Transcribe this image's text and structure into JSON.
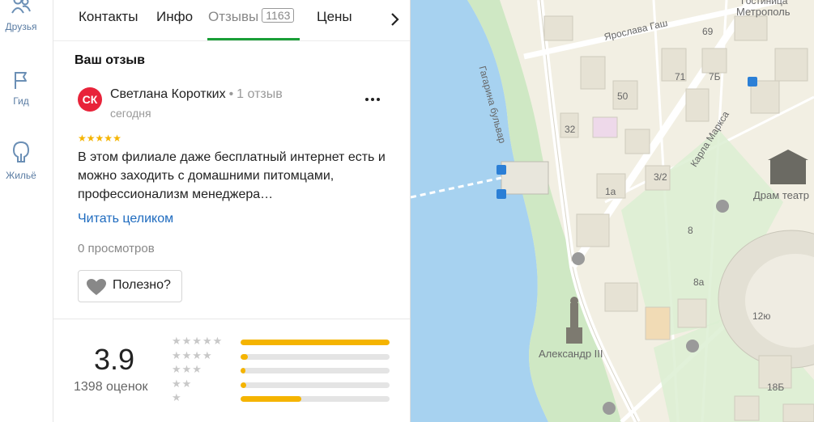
{
  "rail": {
    "items": [
      {
        "label": "Друзья",
        "icon": "friends-icon"
      },
      {
        "label": "Гид",
        "icon": "flag-icon"
      },
      {
        "label": "Жильё",
        "icon": "house-icon"
      }
    ]
  },
  "tabs": {
    "items": [
      {
        "label": "Контакты"
      },
      {
        "label": "Инфо"
      },
      {
        "label": "Отзывы",
        "count": "1163",
        "active": true
      },
      {
        "label": "Цены"
      }
    ],
    "next_icon": "chevron-right-icon"
  },
  "review": {
    "section_title": "Ваш отзыв",
    "avatar_initials": "СК",
    "avatar_color": "#e8233a",
    "author": "Светлана Коротких",
    "separator": "•",
    "author_reviews": "1 отзыв",
    "date": "сегодня",
    "stars": 5,
    "text": "В этом филиале даже бесплатный интернет есть и можно заходить с домашними питомцами, профессионализм менеджера…",
    "read_more": "Читать целиком",
    "views": "0 просмотров",
    "useful_label": "Полезно?"
  },
  "rating": {
    "value": "3.9",
    "count_label": "1398 оценок",
    "distribution": [
      {
        "stars": 5,
        "fraction": 1.0
      },
      {
        "stars": 4,
        "fraction": 0.05
      },
      {
        "stars": 3,
        "fraction": 0.03
      },
      {
        "stars": 2,
        "fraction": 0.04
      },
      {
        "stars": 1,
        "fraction": 0.41
      }
    ],
    "bar_color": "#f5b400"
  },
  "map": {
    "labels": [
      {
        "text": "Гагарина бульвар"
      },
      {
        "text": "Ярослава Гаш"
      },
      {
        "text": "Карла Маркса"
      },
      {
        "text": "Гостиница"
      },
      {
        "text": "Метрополь"
      },
      {
        "text": "Драм театр"
      },
      {
        "text": "Александр III"
      },
      {
        "text": "69"
      },
      {
        "text": "71"
      },
      {
        "text": "7Б"
      },
      {
        "text": "50"
      },
      {
        "text": "32"
      },
      {
        "text": "3/2"
      },
      {
        "text": "1а"
      },
      {
        "text": "8"
      },
      {
        "text": "8а"
      },
      {
        "text": "12ю"
      },
      {
        "text": "18Б"
      }
    ],
    "water_color": "#a7d2f0",
    "land_color": "#f2efe3",
    "park_color": "#cfe8c4"
  }
}
